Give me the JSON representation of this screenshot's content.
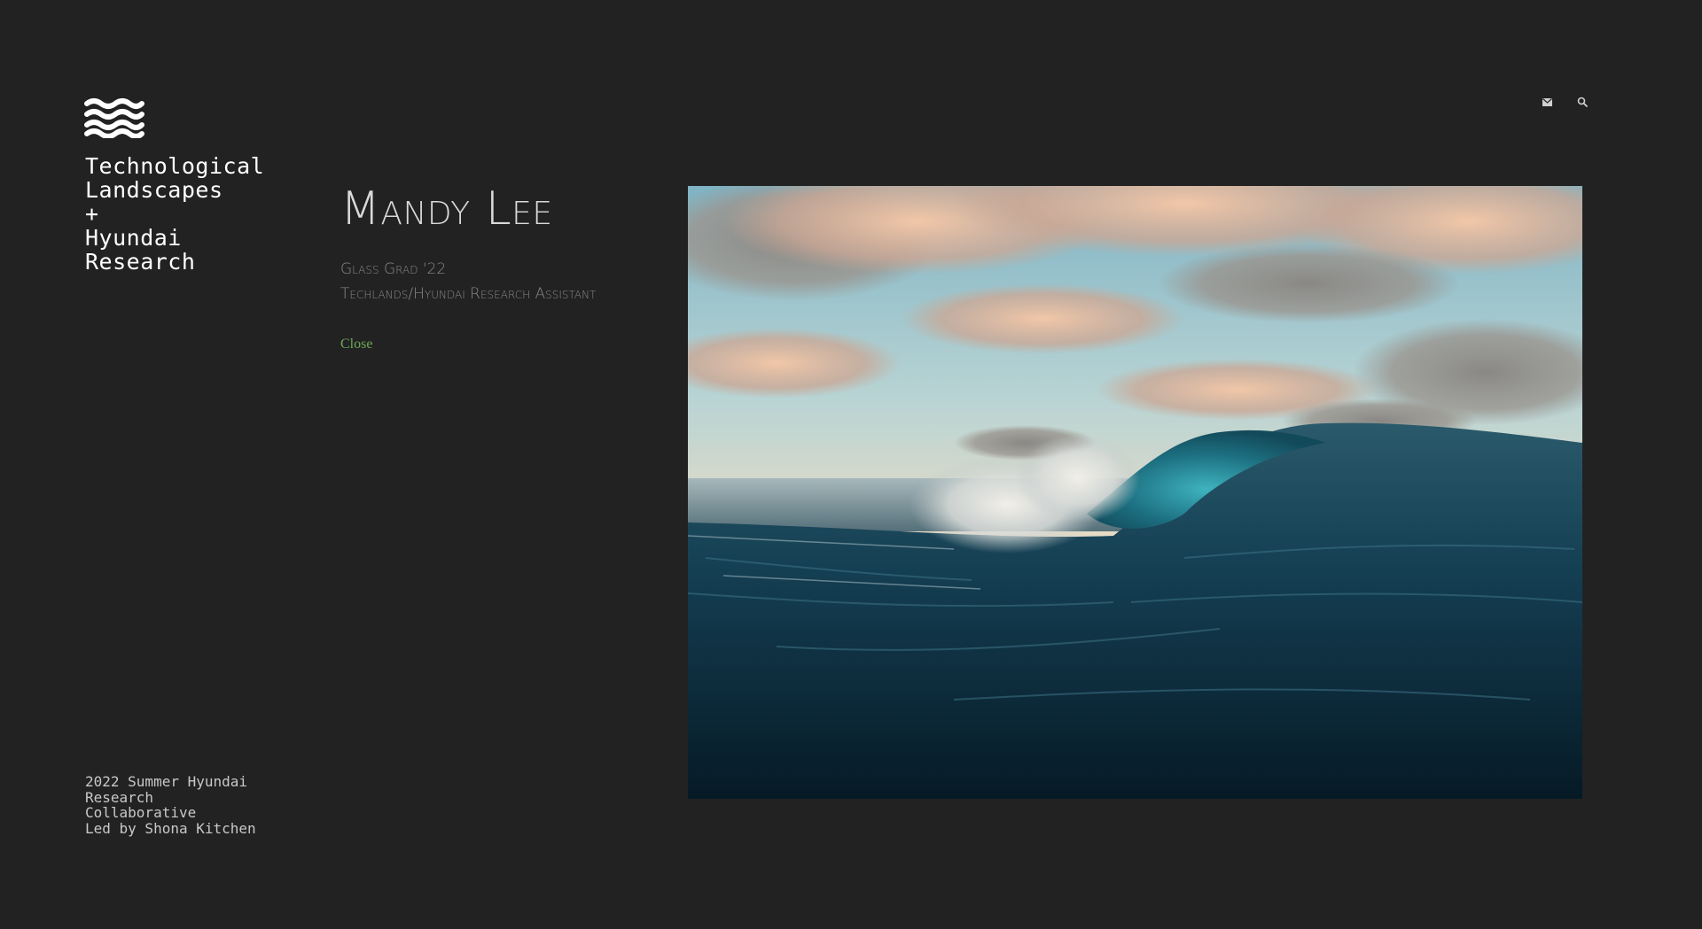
{
  "site": {
    "title_lines": [
      "Technological",
      "Landscapes",
      "+",
      "Hyundai",
      "Research"
    ],
    "logo_icon": "waves-logo-icon",
    "footer_lines": [
      "2022 Summer Hyundai",
      "Research",
      "Collaborative",
      "Led by Shona Kitchen"
    ]
  },
  "header": {
    "icons": [
      {
        "name": "mail-icon"
      },
      {
        "name": "search-icon"
      }
    ]
  },
  "profile": {
    "name": "Mandy Lee",
    "roles": [
      "Glass Grad '22",
      "Techlands/Hyundai Research Assistant"
    ],
    "close_label": "Close"
  },
  "media": {
    "subject": "ocean-wave-image"
  },
  "colors": {
    "background": "#222222",
    "title_text": "#ffffff",
    "name_text": "#d9d9d9",
    "role_text": "#8a8a8a",
    "link_green": "#6fa85a"
  }
}
